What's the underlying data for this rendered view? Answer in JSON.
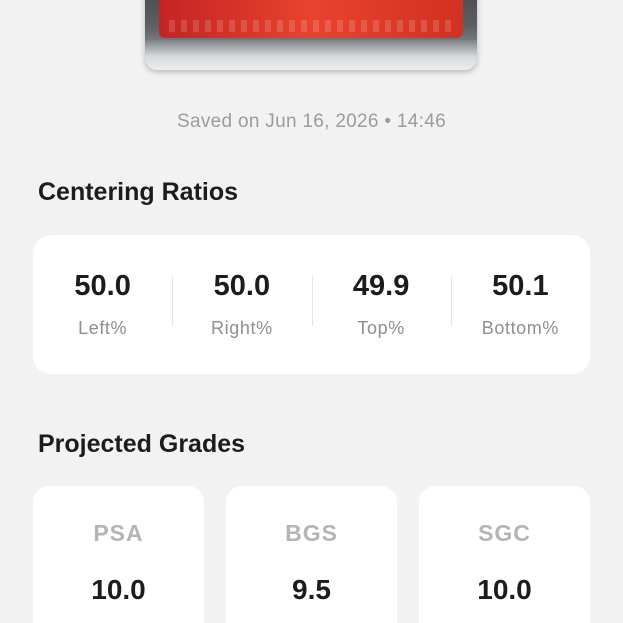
{
  "saved_text": "Saved on Jun 16, 2026 • 14:46",
  "centering": {
    "title": "Centering Ratios",
    "items": [
      {
        "value": "50.0",
        "label": "Left%"
      },
      {
        "value": "50.0",
        "label": "Right%"
      },
      {
        "value": "49.9",
        "label": "Top%"
      },
      {
        "value": "50.1",
        "label": "Bottom%"
      }
    ]
  },
  "projected": {
    "title": "Projected Grades",
    "items": [
      {
        "company": "PSA",
        "score": "10.0"
      },
      {
        "company": "BGS",
        "score": "9.5"
      },
      {
        "company": "SGC",
        "score": "10.0"
      }
    ]
  }
}
